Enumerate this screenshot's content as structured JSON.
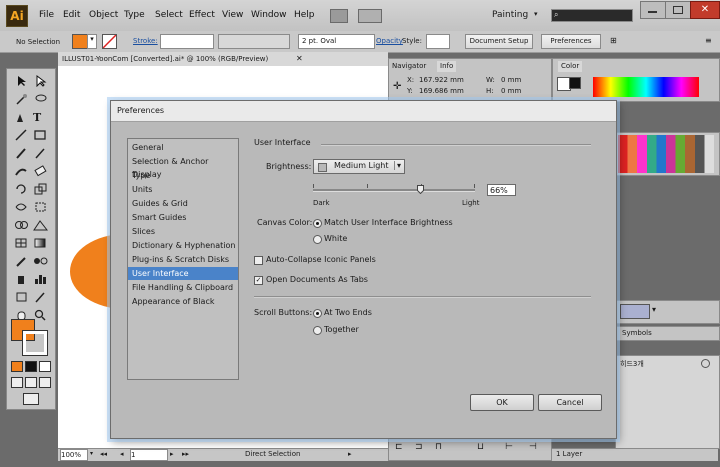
{
  "app": {
    "logo": "Ai"
  },
  "menu": [
    "File",
    "Edit",
    "Object",
    "Type",
    "Select",
    "Effect",
    "View",
    "Window",
    "Help"
  ],
  "toolbar_top": {
    "workspace": "Painting",
    "search_icon": "search-icon"
  },
  "control_bar": {
    "selection": "No Selection",
    "fill_color": "#f0801c",
    "stroke_label": "Stroke:",
    "brush": "2 pt. Oval",
    "opacity_label": "Opacity",
    "style_label": "Style:",
    "document_setup": "Document Setup",
    "preferences": "Preferences"
  },
  "document": {
    "tab_title": "ILLUST01-YoonCom [Converted].ai* @ 100% (RGB/Preview)",
    "zoom": "100%",
    "page": "1",
    "status": "Direct Selection",
    "orange_shape_color": "#f0801c"
  },
  "panels": {
    "navigator_tab": "Navigator",
    "info_tab": "Info",
    "info": {
      "x_label": "X:",
      "x": "167.922 mm",
      "y_label": "Y:",
      "y": "169.686 mm",
      "w_label": "W:",
      "w": "0 mm",
      "h_label": "H:",
      "h": "0 mm"
    },
    "color_tab": "Color",
    "symbols_tab": "Symbols",
    "layers_item": "히드3개",
    "layers_count": "1 Layer"
  },
  "dialog": {
    "title": "Preferences",
    "categories": [
      "General",
      "Selection & Anchor Display",
      "Type",
      "Units",
      "Guides & Grid",
      "Smart Guides",
      "Slices",
      "Dictionary & Hyphenation",
      "Plug-ins & Scratch Disks",
      "User Interface",
      "File Handling & Clipboard",
      "Appearance of Black"
    ],
    "selected_category": "User Interface",
    "section_title": "User Interface",
    "brightness_label": "Brightness:",
    "brightness_value": "Medium Light",
    "slider_dark": "Dark",
    "slider_light": "Light",
    "slider_percent": "66%",
    "canvas_color_label": "Canvas Color:",
    "canvas_opt1": "Match User Interface Brightness",
    "canvas_opt2": "White",
    "auto_collapse": "Auto-Collapse Iconic Panels",
    "open_as_tabs": "Open Documents As Tabs",
    "scroll_buttons_label": "Scroll Buttons:",
    "scroll_opt1": "At Two Ends",
    "scroll_opt2": "Together",
    "ok": "OK",
    "cancel": "Cancel"
  }
}
